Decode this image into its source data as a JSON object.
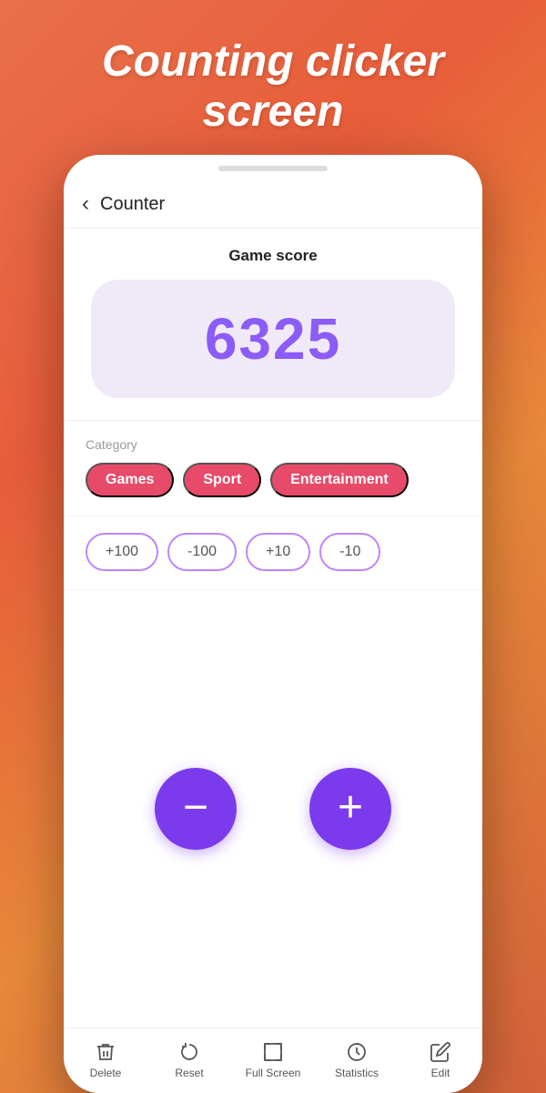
{
  "hero": {
    "title": "Counting clicker screen"
  },
  "phone": {
    "topbar": {
      "back_label": "‹",
      "title": "Counter"
    },
    "score": {
      "label": "Game score",
      "value": "6325"
    },
    "category": {
      "label": "Category",
      "tags": [
        "Games",
        "Sport",
        "Entertainment"
      ]
    },
    "adjustments": {
      "buttons": [
        "+100",
        "-100",
        "+10",
        "-10"
      ]
    },
    "controls": {
      "minus": "−",
      "plus": "+"
    },
    "bottomnav": [
      {
        "name": "delete",
        "label": "Delete"
      },
      {
        "name": "reset",
        "label": "Reset"
      },
      {
        "name": "fullscreen",
        "label": "Full Screen"
      },
      {
        "name": "statistics",
        "label": "Statistics"
      },
      {
        "name": "edit",
        "label": "Edit"
      }
    ]
  }
}
